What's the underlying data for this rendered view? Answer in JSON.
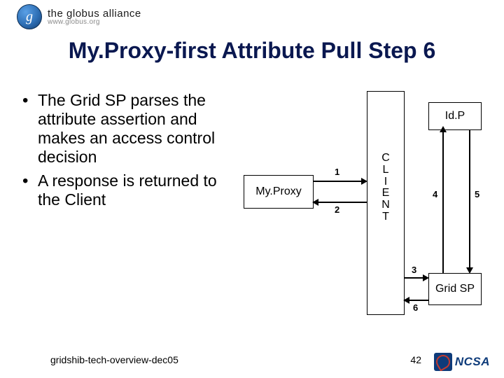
{
  "header": {
    "alliance_line1": "the globus alliance",
    "alliance_line2": "www.globus.org"
  },
  "title": "My.Proxy-first Attribute Pull Step 6",
  "bullets": [
    "The Grid SP parses the attribute assertion and makes an access control decision",
    "A response is returned to the Client"
  ],
  "diagram": {
    "myproxy": "My.Proxy",
    "client_letters": [
      "C",
      "L",
      "I",
      "E",
      "N",
      "T"
    ],
    "idp": "Id.P",
    "gridsp": "Grid SP",
    "labels": {
      "l1": "1",
      "l2": "2",
      "l3": "3",
      "l4": "4",
      "l5": "5",
      "l6": "6"
    }
  },
  "footer": {
    "left": "gridshib-tech-overview-dec05",
    "page": "42",
    "ncsa": "NCSA"
  }
}
